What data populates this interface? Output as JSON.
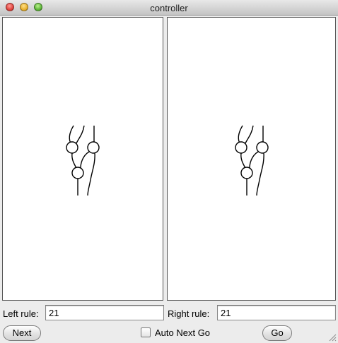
{
  "window": {
    "title": "controller"
  },
  "controls": {
    "left_rule_label": "Left rule:",
    "left_rule_value": "21",
    "right_rule_label": "Right rule:",
    "right_rule_value": "21",
    "next_button": "Next",
    "auto_next_go_label": "Auto Next Go",
    "auto_next_go_checked": false,
    "go_button": "Go"
  }
}
